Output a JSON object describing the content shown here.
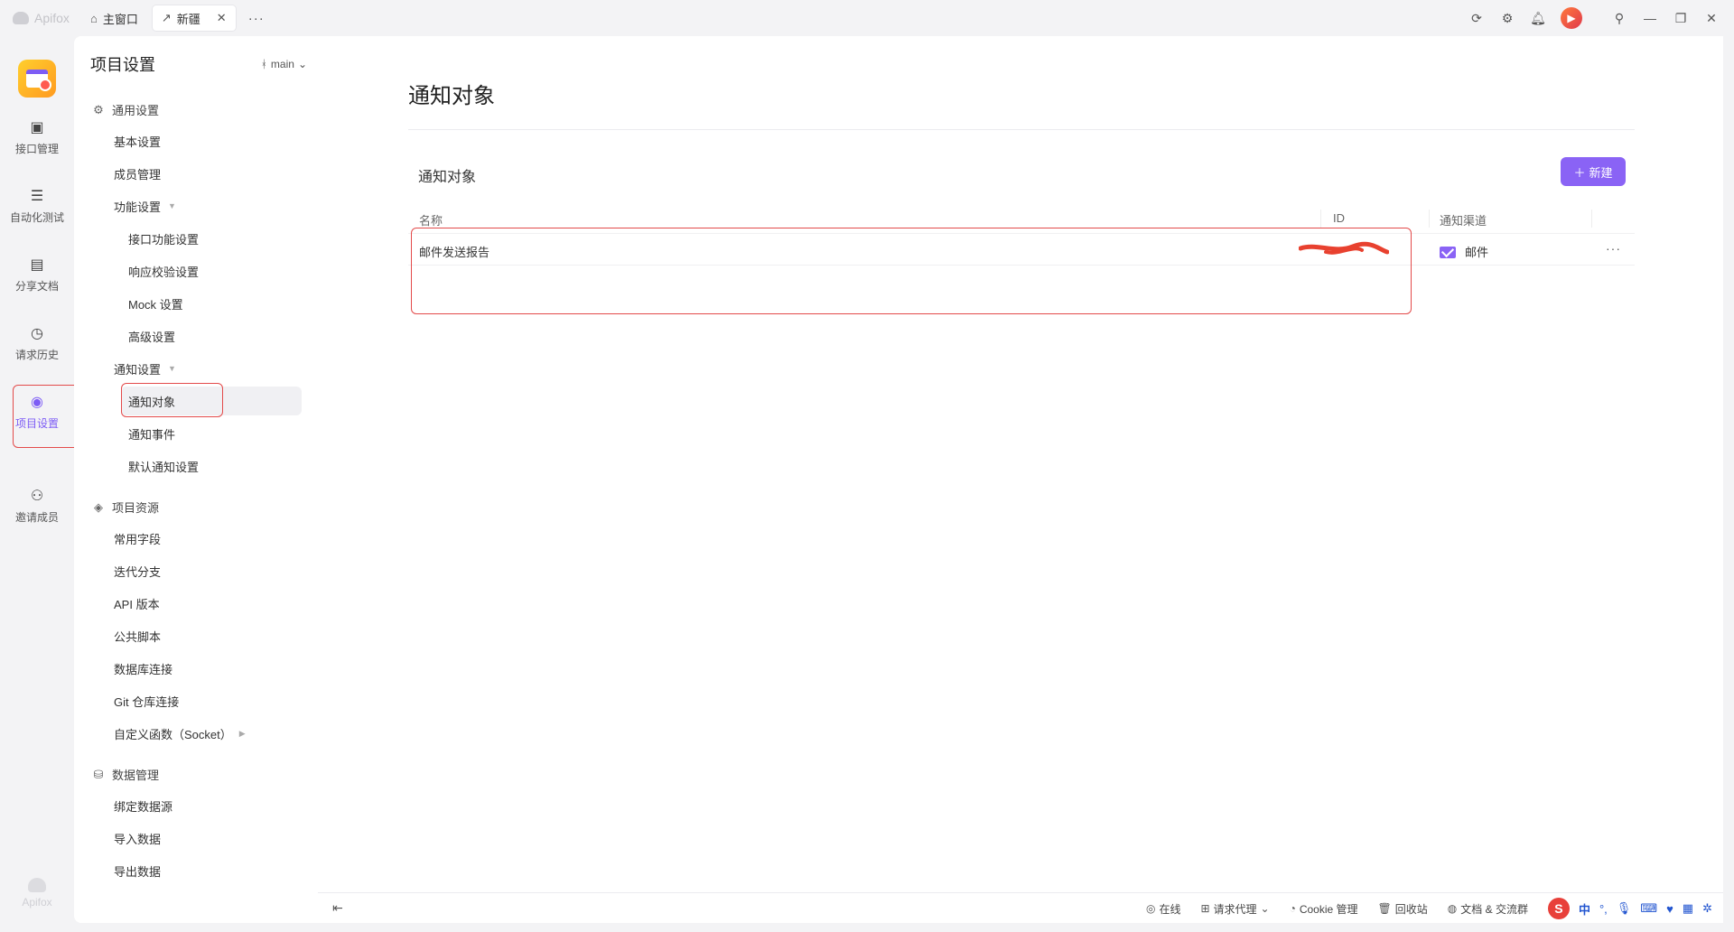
{
  "titlebar": {
    "brand": "Apifox",
    "tabs": [
      {
        "icon": "home-icon",
        "label": "主窗口"
      },
      {
        "icon": "link-icon",
        "label": "新疆"
      }
    ],
    "more": "···"
  },
  "rail": {
    "items": [
      {
        "label": "接口管理",
        "icon": "api-icon"
      },
      {
        "label": "自动化测试",
        "icon": "automation-icon"
      },
      {
        "label": "分享文档",
        "icon": "book-icon"
      },
      {
        "label": "请求历史",
        "icon": "clock-icon"
      },
      {
        "label": "项目设置",
        "icon": "settings-circle-icon"
      },
      {
        "label": "邀请成员",
        "icon": "user-plus-icon"
      }
    ],
    "bottom_brand": "Apifox"
  },
  "sidebar": {
    "title": "项目设置",
    "branch": "main",
    "groups": {
      "general": "通用设置",
      "resources": "项目资源",
      "data": "数据管理"
    },
    "general_items": {
      "basic": "基本设置",
      "members": "成员管理",
      "features": "功能设置",
      "api_features": "接口功能设置",
      "response_validation": "响应校验设置",
      "mock": "Mock 设置",
      "advanced": "高级设置",
      "notify": "通知设置",
      "notify_targets": "通知对象",
      "notify_events": "通知事件",
      "notify_default": "默认通知设置"
    },
    "resource_items": {
      "fields": "常用字段",
      "iteration": "迭代分支",
      "api_version": "API 版本",
      "scripts": "公共脚本",
      "db": "数据库连接",
      "git": "Git 仓库连接",
      "functions": "自定义函数（Socket）"
    },
    "data_items": {
      "bind": "绑定数据源",
      "import": "导入数据",
      "export": "导出数据"
    }
  },
  "main": {
    "page_title": "通知对象",
    "section_title": "通知对象",
    "new_button": "新建",
    "table": {
      "headers": {
        "name": "名称",
        "id": "ID",
        "channel": "通知渠道"
      },
      "rows": [
        {
          "name": "邮件发送报告",
          "channel": "邮件"
        }
      ]
    }
  },
  "statusbar": {
    "online": "在线",
    "proxy": "请求代理",
    "cookie": "Cookie 管理",
    "recycle": "回收站",
    "docs": "文档 & 交流群",
    "ime": "中"
  },
  "colors": {
    "accent": "#8a63f5",
    "annotation": "#e34a4a"
  }
}
